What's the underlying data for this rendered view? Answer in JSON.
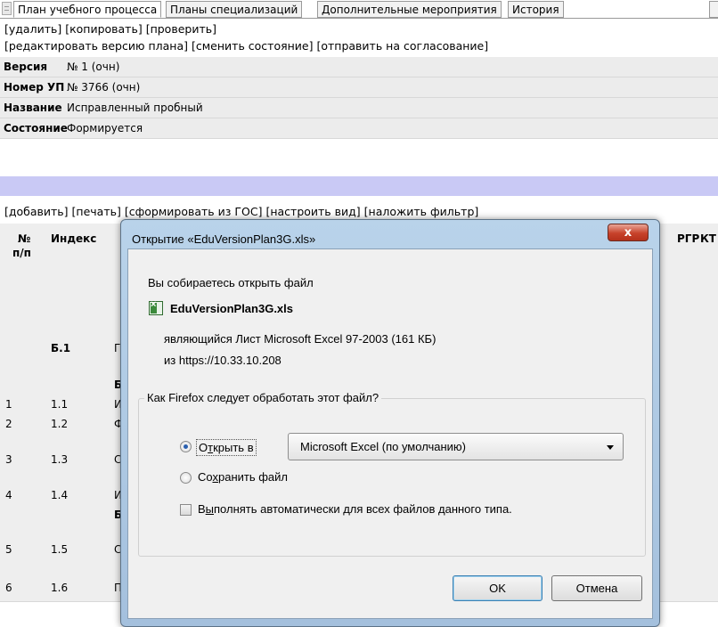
{
  "tabs": [
    {
      "label": "План учебного процесса",
      "active": true
    },
    {
      "label": "Планы специализаций",
      "active": false
    },
    {
      "label": "Дополнительные мероприятия",
      "active": false
    },
    {
      "label": "История",
      "active": false
    }
  ],
  "actions_top": {
    "delete": "[удалить]",
    "copy": "[копировать]",
    "check": "[проверить]"
  },
  "actions_plan": {
    "edit": "[редактировать версию плана]",
    "change_state": "[сменить состояние]",
    "send": "[отправить на согласование]"
  },
  "properties": [
    {
      "label": "Версия",
      "value": "№ 1 (очн)"
    },
    {
      "label": "Номер УП",
      "value": "№ 3766 (очн)"
    },
    {
      "label": "Название",
      "value": "Исправленный пробный"
    },
    {
      "label": "Состояние",
      "value": "Формируется"
    }
  ],
  "actions_table": {
    "add": "[добавить]",
    "print": "[печать]",
    "from_gos": "[сформировать из ГОС]",
    "view": "[настроить вид]",
    "filter": "[наложить фильтр]"
  },
  "table": {
    "headers": {
      "num": "№",
      "num2": "п/п",
      "index": "Индекс",
      "rgr": "РГР",
      "kt": "КТ"
    },
    "rows": [
      {
        "num": "",
        "index": "Б.1",
        "frag": "Г"
      },
      {
        "num": "",
        "index": "",
        "frag": "Б"
      },
      {
        "num": "1",
        "index": "1.1",
        "frag": "И"
      },
      {
        "num": "2",
        "index": "1.2",
        "frag": "Ф"
      },
      {
        "num": "3",
        "index": "1.3",
        "frag": "С"
      },
      {
        "num": "4",
        "index": "1.4",
        "frag": "И"
      },
      {
        "num": "",
        "index": "",
        "frag": "Б"
      },
      {
        "num": "5",
        "index": "1.5",
        "frag": "С"
      },
      {
        "num": "6",
        "index": "1.6",
        "frag": "П"
      }
    ]
  },
  "dialog": {
    "title": "Открытие «EduVersionPlan3G.xls»",
    "close": "x",
    "intro": "Вы собираетесь открыть файл",
    "filename": "EduVersionPlan3G.xls",
    "type_label": "являющийся",
    "type_value": "Лист Microsoft Excel 97-2003 (161 КБ)",
    "from_label": "из",
    "from_value": "https://10.33.10.208",
    "question": "Как Firefox следует обработать этот файл?",
    "open_with": {
      "pre": "О",
      "accel": "т",
      "post": "крыть в"
    },
    "app_selected": "Microsoft Excel (по умолчанию)",
    "save": {
      "pre": "Со",
      "accel": "х",
      "post": "ранить файл"
    },
    "auto": {
      "pre": "В",
      "accel": "ы",
      "post": "полнять автоматически для всех файлов данного типа."
    },
    "ok": "OK",
    "cancel": "Отмена"
  }
}
